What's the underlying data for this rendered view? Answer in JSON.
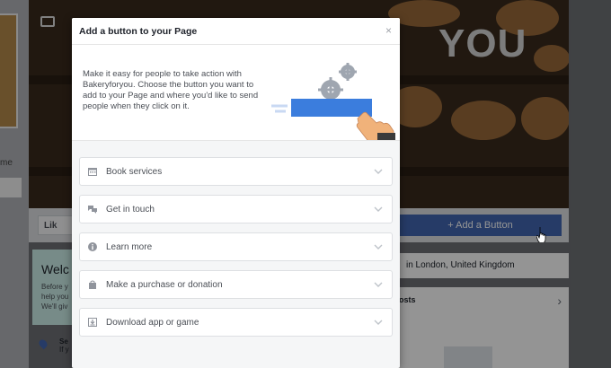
{
  "background": {
    "cover_text": "YOU",
    "like_label": "Lik",
    "add_button_label": "+ Add a Button",
    "location_text": "in London, United Kingdom",
    "posts_label": "osts",
    "welcome_title": "Welc",
    "welcome_lines": [
      "Before y",
      "help you",
      "We'll giv"
    ],
    "left_label": "me",
    "se_label": "Se",
    "se_sub": "If y"
  },
  "dialog": {
    "title": "Add a button to your Page",
    "close_label": "×",
    "intro": "Make it easy for people to take action with Bakeryforyou. Choose the button you want to add to your Page and where you'd like to send people when they click on it.",
    "options": [
      {
        "label": "Book services",
        "icon": "calendar-icon"
      },
      {
        "label": "Get in touch",
        "icon": "chat-icon"
      },
      {
        "label": "Learn more",
        "icon": "info-icon"
      },
      {
        "label": "Make a purchase or donation",
        "icon": "shopping-bag-icon"
      },
      {
        "label": "Download app or game",
        "icon": "download-icon"
      }
    ]
  },
  "colors": {
    "brand_blue": "#4267b2",
    "illus_blue": "#3b7ddd",
    "illus_hand": "#f0b27a"
  }
}
